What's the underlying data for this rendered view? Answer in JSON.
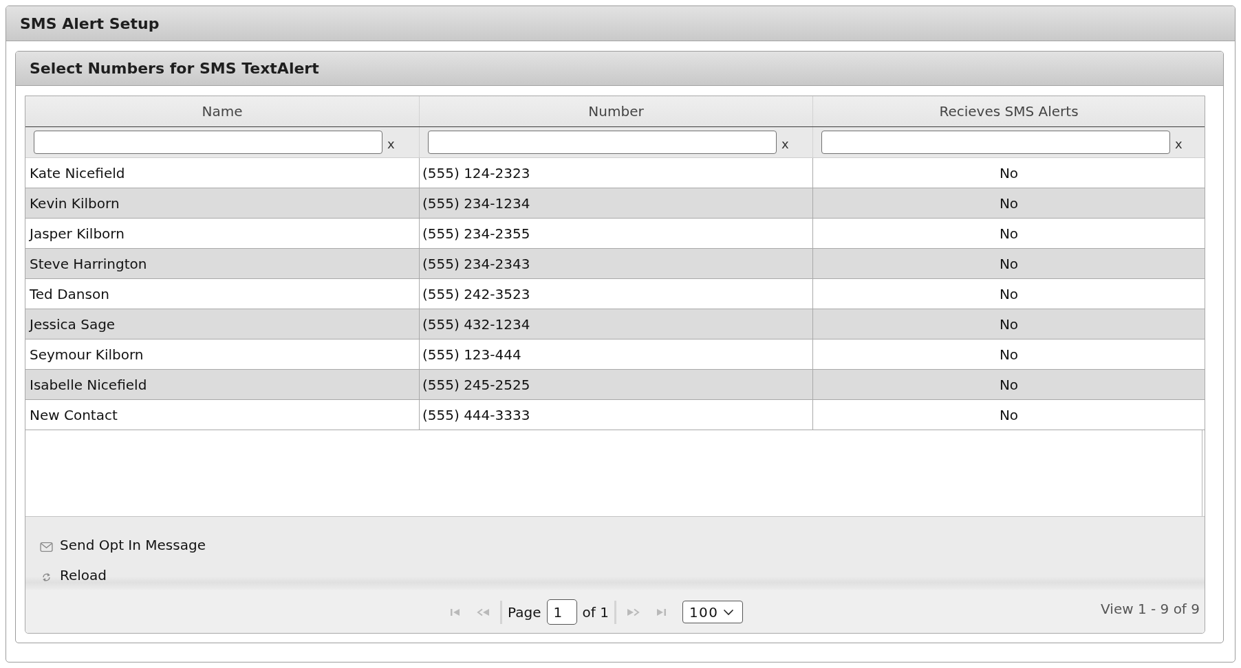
{
  "window": {
    "title": "SMS Alert Setup"
  },
  "panel": {
    "title": "Select Numbers for SMS TextAlert"
  },
  "table": {
    "columns": [
      {
        "label": "Name",
        "filter_clear": "x"
      },
      {
        "label": "Number",
        "filter_clear": "x"
      },
      {
        "label": "Recieves SMS Alerts",
        "filter_clear": "x"
      }
    ],
    "rows": [
      [
        "Kate Nicefield",
        "(555) 124-2323",
        "No"
      ],
      [
        "Kevin Kilborn",
        "(555) 234-1234",
        "No"
      ],
      [
        "Jasper Kilborn",
        "(555) 234-2355",
        "No"
      ],
      [
        "Steve Harrington",
        "(555) 234-2343",
        "No"
      ],
      [
        "Ted Danson",
        "(555) 242-3523",
        "No"
      ],
      [
        "Jessica Sage",
        "(555) 432-1234",
        "No"
      ],
      [
        "Seymour Kilborn",
        "(555) 123-444",
        "No"
      ],
      [
        "Isabelle Nicefield",
        "(555) 245-2525",
        "No"
      ],
      [
        "New Contact",
        "(555) 444-3333",
        "No"
      ]
    ]
  },
  "toolbar": [
    {
      "kind": "mail",
      "label": "Send Opt In Message"
    },
    {
      "kind": "reload",
      "label": "Reload"
    }
  ],
  "pager": {
    "back_buttons": [
      {
        "kind": "first",
        "disabled": true
      },
      {
        "kind": "prev",
        "disabled": true
      }
    ],
    "page_label": "Page",
    "page": "1",
    "of_label": "of 1",
    "forward_buttons": [
      {
        "kind": "next",
        "disabled": true
      },
      {
        "kind": "last",
        "disabled": true
      }
    ],
    "page_size": "100",
    "summary": "View 1 - 9 of 9"
  }
}
